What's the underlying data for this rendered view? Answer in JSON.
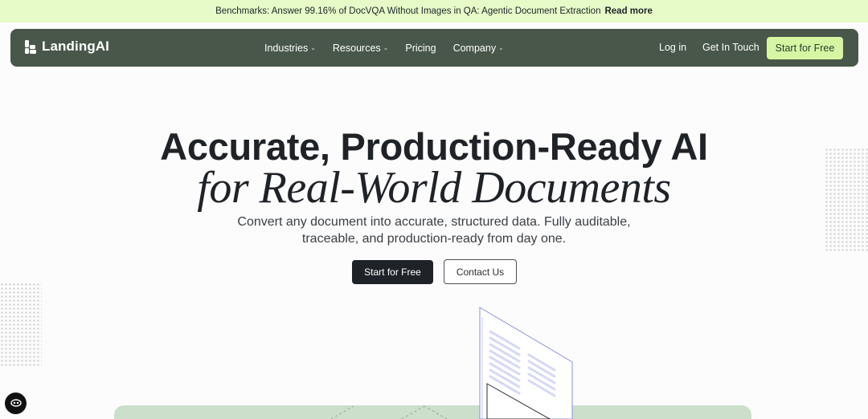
{
  "banner": {
    "text": "Benchmarks: Answer 99.16% of DocVQA Without Images in QA: Agentic Document Extraction",
    "link": "Read more"
  },
  "nav": {
    "logo": "LandingAI",
    "menu": [
      {
        "label": "Industries",
        "has_dropdown": true
      },
      {
        "label": "Resources",
        "has_dropdown": true
      },
      {
        "label": "Pricing",
        "has_dropdown": false
      },
      {
        "label": "Company",
        "has_dropdown": true
      }
    ],
    "login": "Log in",
    "contact": "Get In Touch",
    "cta": "Start for Free"
  },
  "hero": {
    "title_line1": "Accurate, Production-Ready AI",
    "title_line2": "for Real-World Documents",
    "subtitle": "Convert any document into accurate, structured data. Fully auditable, traceable, and production-ready from day one.",
    "primary_button": "Start for Free",
    "secondary_button": "Contact Us"
  },
  "icons": {
    "logo": "landingai-logo-icon",
    "dropdown": "chevron-down-icon",
    "chat": "chat-widget-icon"
  },
  "colors": {
    "banner_bg": "#e6fbc8",
    "nav_bg": "#485749",
    "nav_cta_bg": "#d7f6a3",
    "primary_btn_bg": "#1f2329",
    "card_bg": "#cbdfca"
  }
}
